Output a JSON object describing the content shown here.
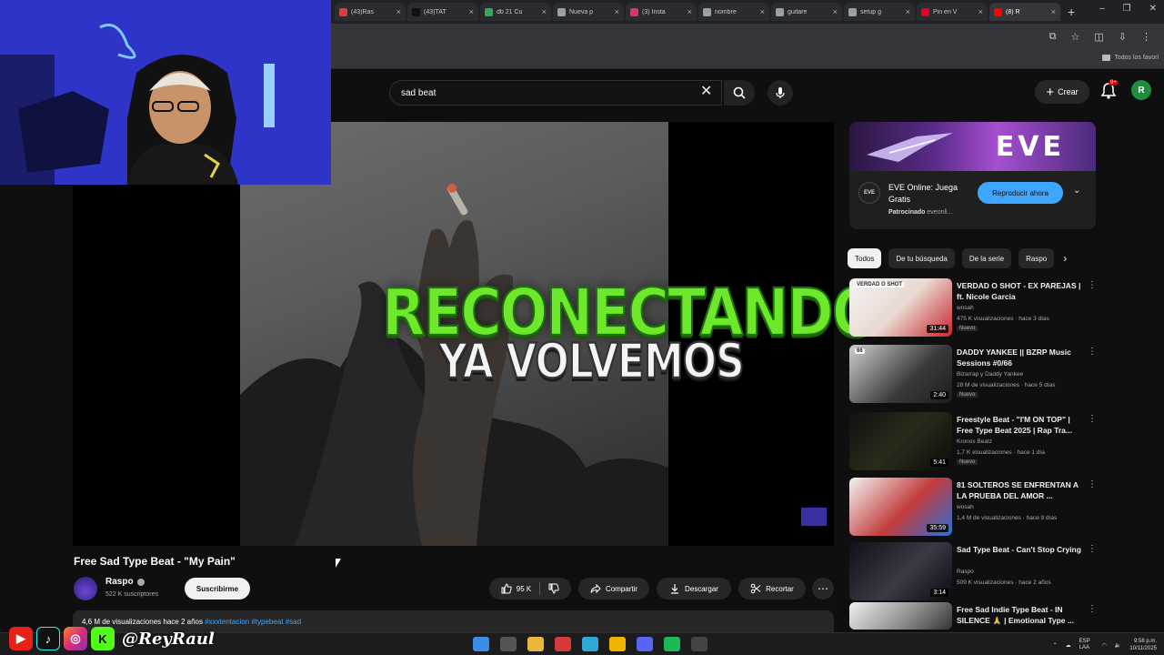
{
  "browser": {
    "tabs": [
      {
        "label": "(43)Ras",
        "color": "#e53935"
      },
      {
        "label": "(43)TAT",
        "color": "#111111"
      },
      {
        "label": "db 21 Cu",
        "color": "#34a853"
      },
      {
        "label": "Nueva p",
        "color": "#9aa0a6"
      },
      {
        "label": "(3) Insta",
        "color": "#e1306c"
      },
      {
        "label": "nombre",
        "color": "#9aa0a6"
      },
      {
        "label": "guitare",
        "color": "#9aa0a6"
      },
      {
        "label": "setup g",
        "color": "#9aa0a6"
      },
      {
        "label": "Pin en V",
        "color": "#e60023"
      },
      {
        "label": "(8) R",
        "color": "#ff0000"
      }
    ],
    "bookmarks_folder": "Todos los favori"
  },
  "header": {
    "search_value": "sad beat",
    "create_label": "Crear",
    "notifications_badge": "9+",
    "avatar_letter": "R"
  },
  "overlay": {
    "title": "RECONECTANDO",
    "subtitle": "YA VOLVEMOS"
  },
  "video": {
    "title": "Free Sad Type Beat - \"My Pain\"",
    "channel": "Raspo",
    "subscribers": "522 K suscriptores",
    "subscribe_label": "Suscribirme",
    "likes": "95 K",
    "share_label": "Compartir",
    "download_label": "Descargar",
    "clip_label": "Recortar",
    "description_meta": "4,6 M de visualizaciones  hace 2 años",
    "description_tags": "#xxxtentacion #typebeat #sad"
  },
  "ad": {
    "brand": "EVE",
    "title": "EVE Online: Juega Gratis",
    "sponsored_label": "Patrocinado",
    "sponsor_domain": "eveonli...",
    "cta_label": "Reproducir ahora"
  },
  "chips": [
    "Todos",
    "De tu búsqueda",
    "De la serie",
    "Raspo"
  ],
  "recommended": [
    {
      "title": "VERDAD O SHOT - EX PAREJAS | ft. Nicole Garcia",
      "channel": "wosah",
      "meta": "475 K visualizaciones · hace 3 días",
      "duration": "31:44",
      "tag": "Nuevo",
      "thumb_text": "VERDAD O SHOT"
    },
    {
      "title": "DADDY YANKEE || BZRP Music Sessions #0/66",
      "channel": "Bizarrap y Daddy Yankee",
      "meta": "28 M de visualizaciones · hace 5 días",
      "duration": "2:40",
      "tag": "Nuevo",
      "thumb_text": "66"
    },
    {
      "title": "Freestyle Beat - \"I'M ON TOP\" | Free Type Beat 2025 | Rap Tra...",
      "channel": "Kronos Beatz",
      "meta": "1,7 K visualizaciones · hace 1 día",
      "duration": "5:41",
      "tag": "Nuevo",
      "thumb_text": ""
    },
    {
      "title": "81 SOLTEROS SE ENFRENTAN A LA PRUEBA DEL AMOR ...",
      "channel": "wosah",
      "meta": "1,4 M de visualizaciones · hace 9 días",
      "duration": "35:59",
      "tag": "",
      "thumb_text": ""
    },
    {
      "title": "Sad Type Beat - Can't Stop Crying",
      "channel": "Raspo",
      "meta": "509 K visualizaciones · hace 2 años",
      "duration": "3:14",
      "tag": "",
      "thumb_text": ""
    },
    {
      "title": "Free Sad Indie Type Beat - IN SILENCE 🙏 | Emotional Type ...",
      "channel": "",
      "meta": "",
      "duration": "",
      "tag": "",
      "thumb_text": ""
    }
  ],
  "stream": {
    "handle": "@ReyRaul"
  },
  "taskbar": {
    "lang": "ESP LAA",
    "time": "9:58 p.m.",
    "date": "10/11/2025"
  }
}
